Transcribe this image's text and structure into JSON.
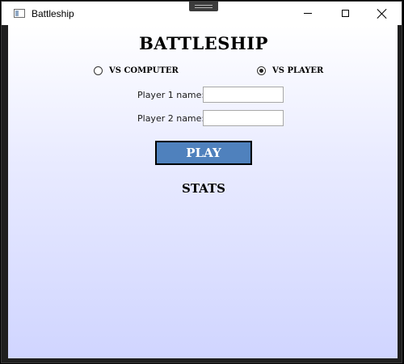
{
  "window": {
    "title": "Battleship",
    "controls": {
      "minimize_icon": "minimize-icon",
      "maximize_icon": "maximize-icon",
      "close_icon": "close-icon"
    }
  },
  "main": {
    "heading": "BATTLESHIP",
    "mode_options": [
      {
        "label": "VS COMPUTER",
        "selected": false
      },
      {
        "label": "VS PLAYER",
        "selected": true
      }
    ],
    "player1": {
      "label": "Player 1 name:",
      "value": ""
    },
    "player2": {
      "label": "Player 2 name:",
      "value": ""
    },
    "play_label": "PLAY",
    "stats_label": "STATS"
  },
  "colors": {
    "play_button": "#4f81bd",
    "background_top": "#ffffff",
    "background_bottom": "#d0d5ff"
  }
}
